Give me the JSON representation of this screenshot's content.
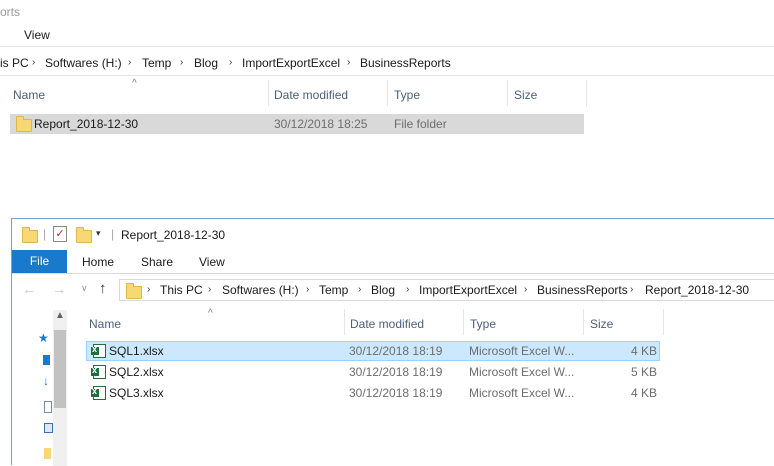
{
  "back_window": {
    "title_fragment": "orts",
    "ribbon_tab_view": "View",
    "breadcrumb": [
      "is PC",
      "Softwares (H:)",
      "Temp",
      "Blog",
      "ImportExportExcel",
      "BusinessReports"
    ],
    "columns": {
      "name": "Name",
      "date": "Date modified",
      "type": "Type",
      "size": "Size"
    },
    "rows": [
      {
        "name": "Report_2018-12-30",
        "date": "30/12/2018 18:25",
        "type": "File folder",
        "size": ""
      }
    ]
  },
  "front_window": {
    "title": "Report_2018-12-30",
    "tabs": {
      "file": "File",
      "home": "Home",
      "share": "Share",
      "view": "View"
    },
    "breadcrumb": [
      "This PC",
      "Softwares (H:)",
      "Temp",
      "Blog",
      "ImportExportExcel",
      "BusinessReports",
      "Report_2018-12-30"
    ],
    "columns": {
      "name": "Name",
      "date": "Date modified",
      "type": "Type",
      "size": "Size"
    },
    "rows": [
      {
        "name": "SQL1.xlsx",
        "date": "30/12/2018 18:19",
        "type": "Microsoft Excel W...",
        "size": "4 KB"
      },
      {
        "name": "SQL2.xlsx",
        "date": "30/12/2018 18:19",
        "type": "Microsoft Excel W...",
        "size": "5 KB"
      },
      {
        "name": "SQL3.xlsx",
        "date": "30/12/2018 18:19",
        "type": "Microsoft Excel W...",
        "size": "4 KB"
      }
    ]
  },
  "colors": {
    "file_tab": "#1979ca",
    "selected_row_back": "#d9d9d9",
    "selected_row_front": "#cce8ff",
    "selected_row_border": "#99d1ff",
    "header_text": "#4c607a",
    "meta_text": "#6d6d6d"
  }
}
